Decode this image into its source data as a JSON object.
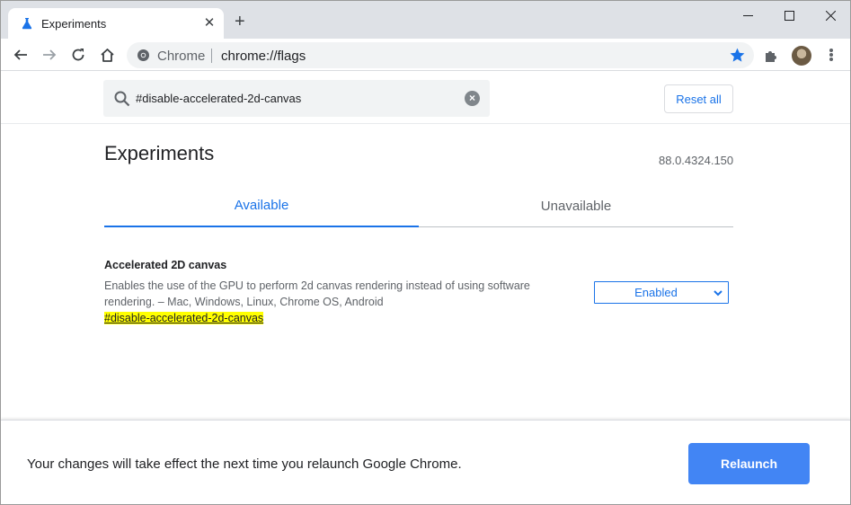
{
  "browser": {
    "tab_title": "Experiments",
    "new_tab_symbol": "+",
    "tab_close_symbol": "✕",
    "site_chip": "Chrome",
    "url": "chrome://flags",
    "icons": [
      "flask-icon",
      "back-arrow-icon",
      "forward-arrow-icon",
      "reload-icon",
      "home-icon",
      "chrome-logo-icon",
      "star-icon",
      "puzzle-icon",
      "avatar",
      "kebab-menu-icon",
      "minimize-icon",
      "maximize-icon",
      "close-icon"
    ],
    "accent_color": "#1a73e8"
  },
  "header": {
    "search_value": "#disable-accelerated-2d-canvas",
    "clear_symbol": "×",
    "reset_label": "Reset all"
  },
  "main": {
    "title": "Experiments",
    "version": "88.0.4324.150",
    "tabs": [
      {
        "label": "Available",
        "active": true
      },
      {
        "label": "Unavailable",
        "active": false
      }
    ],
    "experiment": {
      "name": "Accelerated 2D canvas",
      "description": "Enables the use of the GPU to perform 2d canvas rendering instead of using software rendering. – Mac, Windows, Linux, Chrome OS, Android",
      "link": "#disable-accelerated-2d-canvas",
      "selected_option": "Enabled",
      "highlight_color": "#ffff00"
    }
  },
  "relaunch": {
    "message": "Your changes will take effect the next time you relaunch Google Chrome.",
    "button_label": "Relaunch",
    "button_color": "#4285f4"
  }
}
